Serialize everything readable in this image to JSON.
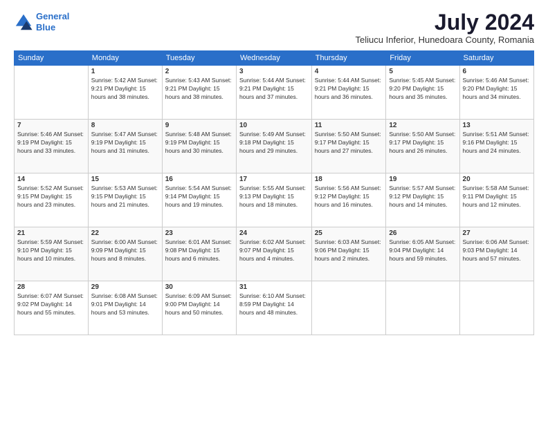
{
  "logo": {
    "line1": "General",
    "line2": "Blue"
  },
  "title": "July 2024",
  "location": "Teliucu Inferior, Hunedoara County, Romania",
  "days_of_week": [
    "Sunday",
    "Monday",
    "Tuesday",
    "Wednesday",
    "Thursday",
    "Friday",
    "Saturday"
  ],
  "weeks": [
    [
      {
        "day": "",
        "info": ""
      },
      {
        "day": "1",
        "info": "Sunrise: 5:42 AM\nSunset: 9:21 PM\nDaylight: 15 hours\nand 38 minutes."
      },
      {
        "day": "2",
        "info": "Sunrise: 5:43 AM\nSunset: 9:21 PM\nDaylight: 15 hours\nand 38 minutes."
      },
      {
        "day": "3",
        "info": "Sunrise: 5:44 AM\nSunset: 9:21 PM\nDaylight: 15 hours\nand 37 minutes."
      },
      {
        "day": "4",
        "info": "Sunrise: 5:44 AM\nSunset: 9:21 PM\nDaylight: 15 hours\nand 36 minutes."
      },
      {
        "day": "5",
        "info": "Sunrise: 5:45 AM\nSunset: 9:20 PM\nDaylight: 15 hours\nand 35 minutes."
      },
      {
        "day": "6",
        "info": "Sunrise: 5:46 AM\nSunset: 9:20 PM\nDaylight: 15 hours\nand 34 minutes."
      }
    ],
    [
      {
        "day": "7",
        "info": "Sunrise: 5:46 AM\nSunset: 9:19 PM\nDaylight: 15 hours\nand 33 minutes."
      },
      {
        "day": "8",
        "info": "Sunrise: 5:47 AM\nSunset: 9:19 PM\nDaylight: 15 hours\nand 31 minutes."
      },
      {
        "day": "9",
        "info": "Sunrise: 5:48 AM\nSunset: 9:19 PM\nDaylight: 15 hours\nand 30 minutes."
      },
      {
        "day": "10",
        "info": "Sunrise: 5:49 AM\nSunset: 9:18 PM\nDaylight: 15 hours\nand 29 minutes."
      },
      {
        "day": "11",
        "info": "Sunrise: 5:50 AM\nSunset: 9:17 PM\nDaylight: 15 hours\nand 27 minutes."
      },
      {
        "day": "12",
        "info": "Sunrise: 5:50 AM\nSunset: 9:17 PM\nDaylight: 15 hours\nand 26 minutes."
      },
      {
        "day": "13",
        "info": "Sunrise: 5:51 AM\nSunset: 9:16 PM\nDaylight: 15 hours\nand 24 minutes."
      }
    ],
    [
      {
        "day": "14",
        "info": "Sunrise: 5:52 AM\nSunset: 9:15 PM\nDaylight: 15 hours\nand 23 minutes."
      },
      {
        "day": "15",
        "info": "Sunrise: 5:53 AM\nSunset: 9:15 PM\nDaylight: 15 hours\nand 21 minutes."
      },
      {
        "day": "16",
        "info": "Sunrise: 5:54 AM\nSunset: 9:14 PM\nDaylight: 15 hours\nand 19 minutes."
      },
      {
        "day": "17",
        "info": "Sunrise: 5:55 AM\nSunset: 9:13 PM\nDaylight: 15 hours\nand 18 minutes."
      },
      {
        "day": "18",
        "info": "Sunrise: 5:56 AM\nSunset: 9:12 PM\nDaylight: 15 hours\nand 16 minutes."
      },
      {
        "day": "19",
        "info": "Sunrise: 5:57 AM\nSunset: 9:12 PM\nDaylight: 15 hours\nand 14 minutes."
      },
      {
        "day": "20",
        "info": "Sunrise: 5:58 AM\nSunset: 9:11 PM\nDaylight: 15 hours\nand 12 minutes."
      }
    ],
    [
      {
        "day": "21",
        "info": "Sunrise: 5:59 AM\nSunset: 9:10 PM\nDaylight: 15 hours\nand 10 minutes."
      },
      {
        "day": "22",
        "info": "Sunrise: 6:00 AM\nSunset: 9:09 PM\nDaylight: 15 hours\nand 8 minutes."
      },
      {
        "day": "23",
        "info": "Sunrise: 6:01 AM\nSunset: 9:08 PM\nDaylight: 15 hours\nand 6 minutes."
      },
      {
        "day": "24",
        "info": "Sunrise: 6:02 AM\nSunset: 9:07 PM\nDaylight: 15 hours\nand 4 minutes."
      },
      {
        "day": "25",
        "info": "Sunrise: 6:03 AM\nSunset: 9:06 PM\nDaylight: 15 hours\nand 2 minutes."
      },
      {
        "day": "26",
        "info": "Sunrise: 6:05 AM\nSunset: 9:04 PM\nDaylight: 14 hours\nand 59 minutes."
      },
      {
        "day": "27",
        "info": "Sunrise: 6:06 AM\nSunset: 9:03 PM\nDaylight: 14 hours\nand 57 minutes."
      }
    ],
    [
      {
        "day": "28",
        "info": "Sunrise: 6:07 AM\nSunset: 9:02 PM\nDaylight: 14 hours\nand 55 minutes."
      },
      {
        "day": "29",
        "info": "Sunrise: 6:08 AM\nSunset: 9:01 PM\nDaylight: 14 hours\nand 53 minutes."
      },
      {
        "day": "30",
        "info": "Sunrise: 6:09 AM\nSunset: 9:00 PM\nDaylight: 14 hours\nand 50 minutes."
      },
      {
        "day": "31",
        "info": "Sunrise: 6:10 AM\nSunset: 8:59 PM\nDaylight: 14 hours\nand 48 minutes."
      },
      {
        "day": "",
        "info": ""
      },
      {
        "day": "",
        "info": ""
      },
      {
        "day": "",
        "info": ""
      }
    ]
  ]
}
